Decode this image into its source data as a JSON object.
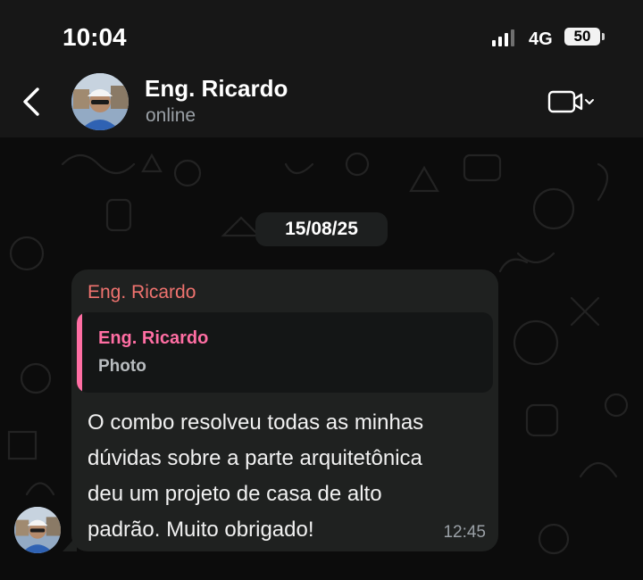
{
  "status_bar": {
    "time": "10:04",
    "network": "4G",
    "battery": "50",
    "icons": [
      "signal-bars-icon",
      "battery-icon"
    ]
  },
  "header": {
    "contact_name": "Eng. Ricardo",
    "contact_status": "online",
    "icons": [
      "back-arrow-icon",
      "video-camera-icon",
      "chevron-down-icon"
    ]
  },
  "chat": {
    "date_label": "15/08/25",
    "messages": [
      {
        "sender": "Eng. Ricardo",
        "reply_to": {
          "author": "Eng. Ricardo",
          "type": "Photo"
        },
        "text": "O combo resolveu todas as minhas\ndúvidas sobre a parte arquitetônica\ndeu um projeto de casa de alto\npadrão. Muito obrigado!",
        "time": "12:45"
      }
    ]
  },
  "colors": {
    "background": "#0b0b0b",
    "header": "#171717",
    "bubble": "#1f2120",
    "sender_name": "#f0736f",
    "quote_accent": "#ff6ea3"
  }
}
